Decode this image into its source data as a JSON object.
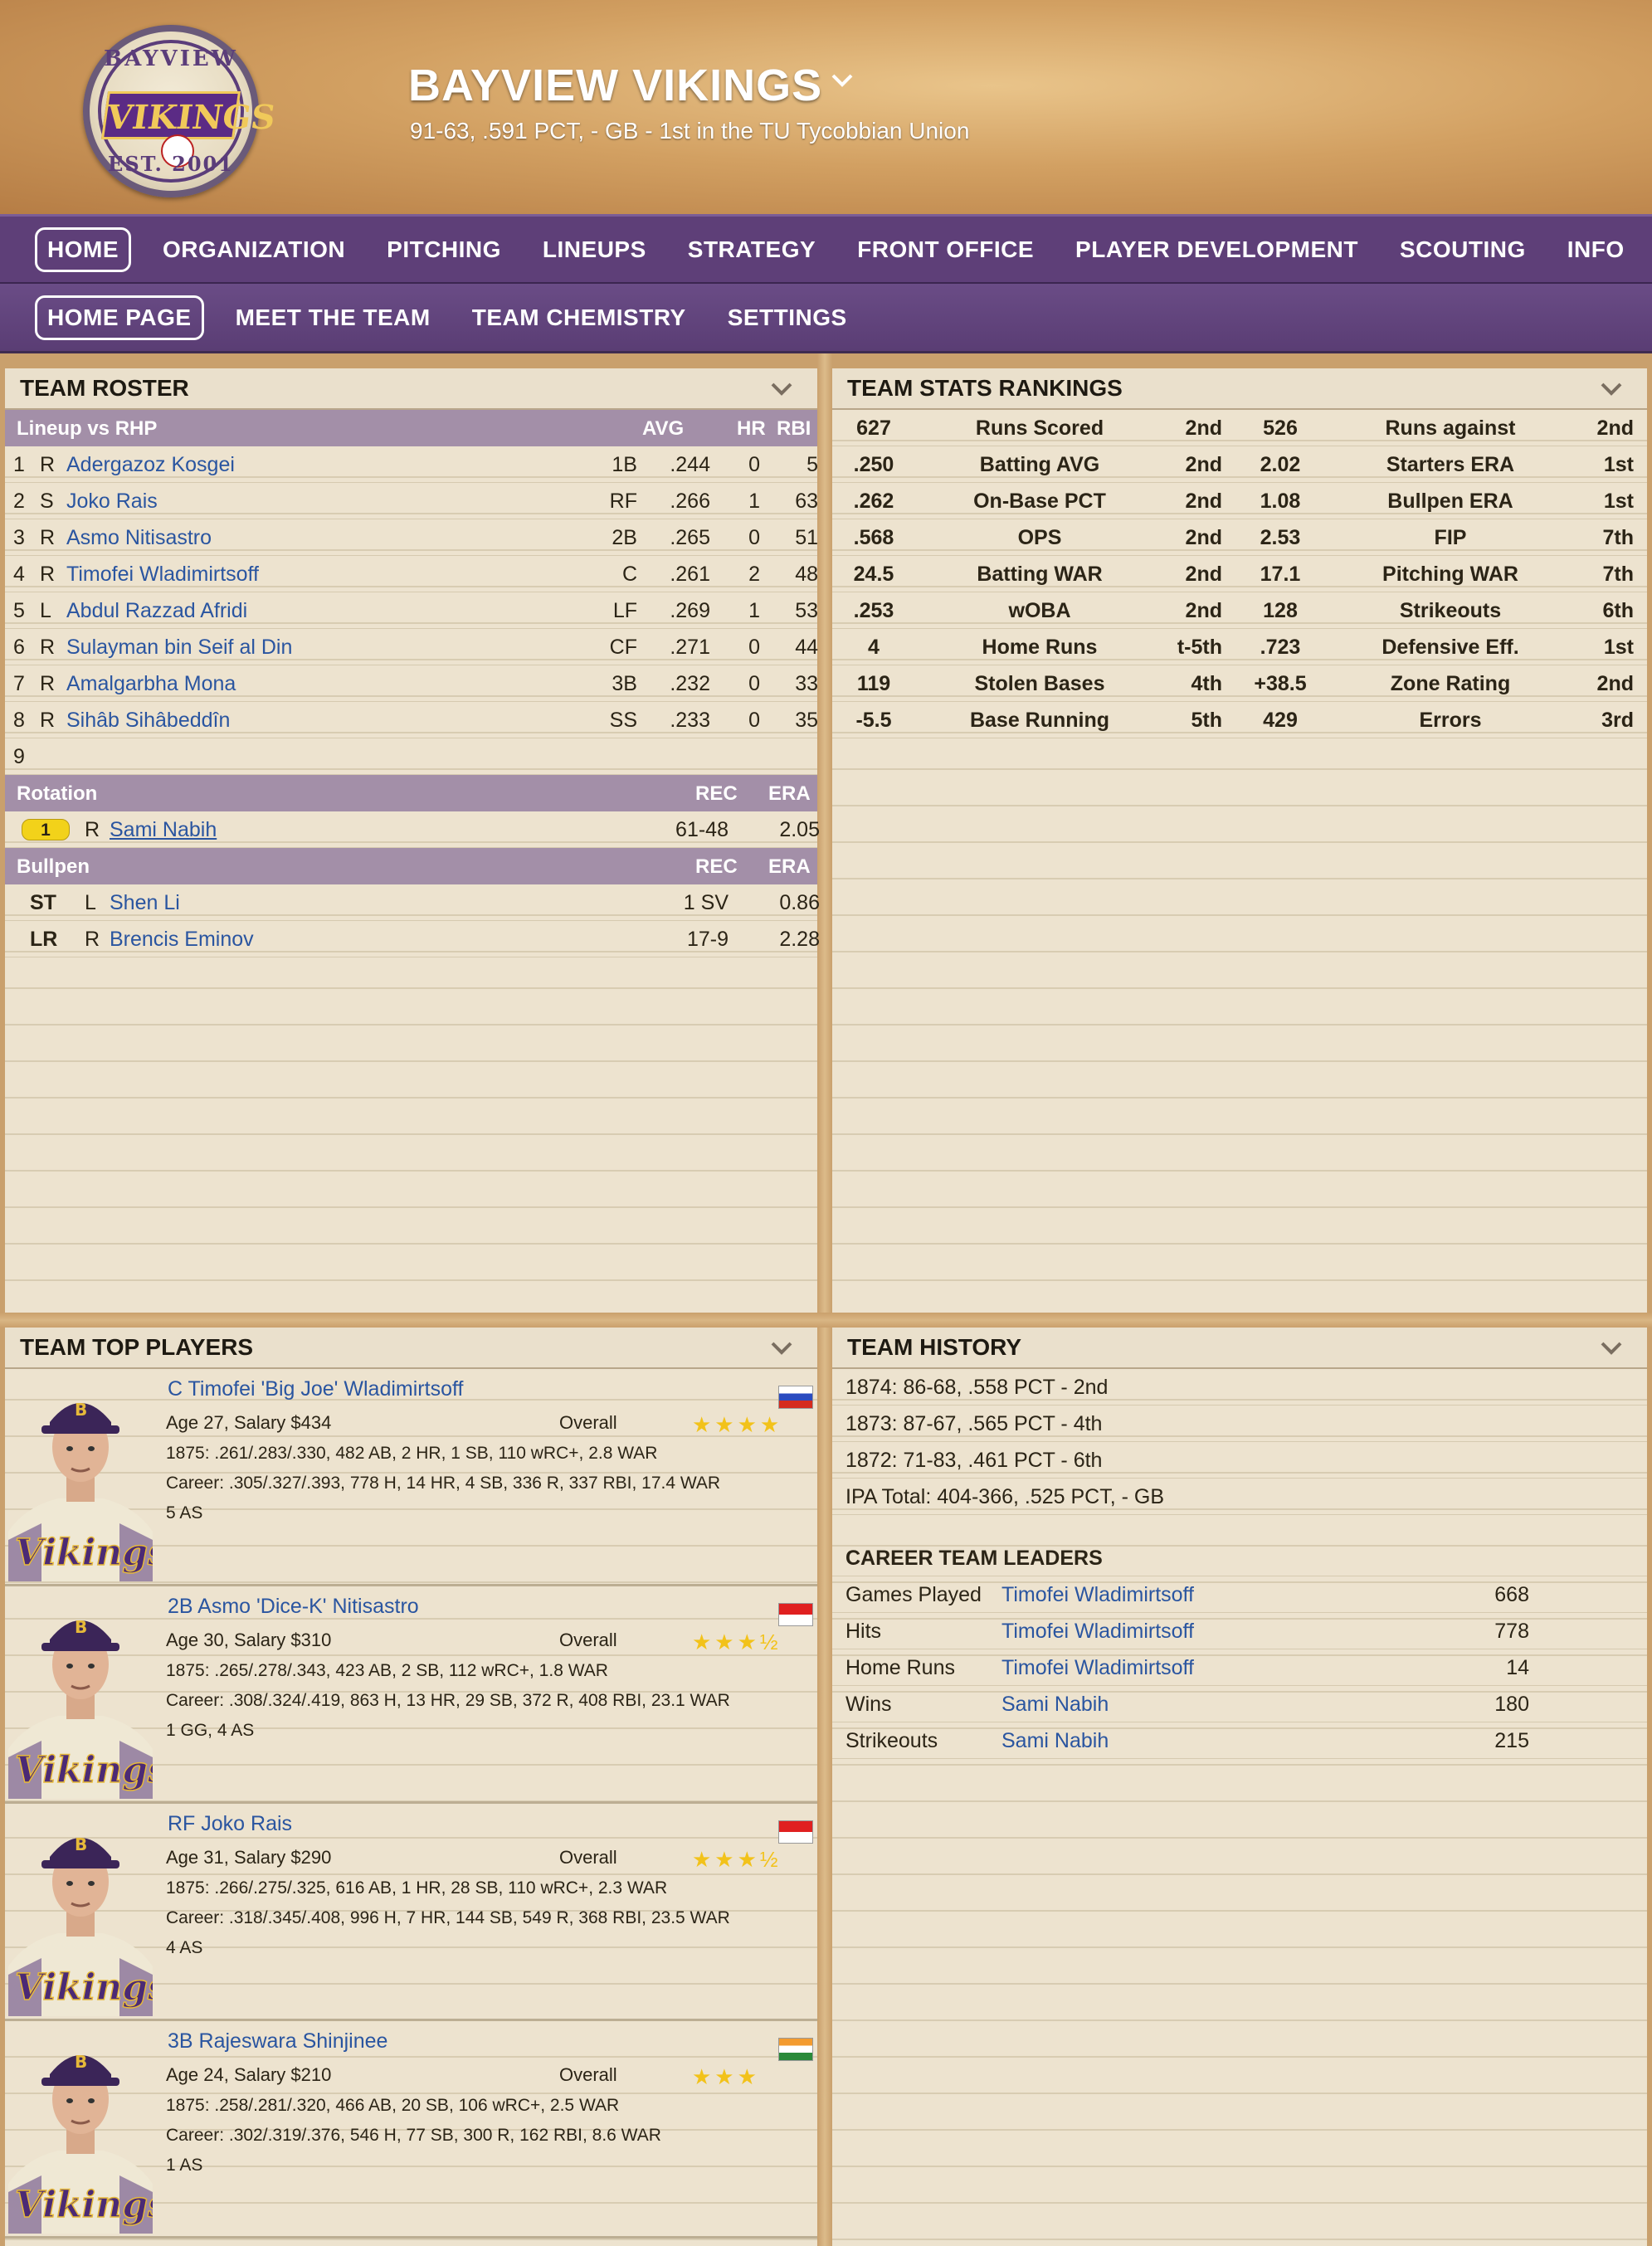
{
  "header": {
    "team_name": "BAYVIEW VIKINGS",
    "subtitle": "91-63, .591 PCT, - GB - 1st in the TU Tycobbian Union",
    "logo": {
      "top": "BAYVIEW",
      "word": "VIKINGS",
      "bottom": "EST. 2001"
    }
  },
  "nav": {
    "primary": [
      "HOME",
      "ORGANIZATION",
      "PITCHING",
      "LINEUPS",
      "STRATEGY",
      "FRONT OFFICE",
      "PLAYER DEVELOPMENT",
      "SCOUTING",
      "INFO"
    ],
    "secondary": [
      "HOME PAGE",
      "MEET THE TEAM",
      "TEAM CHEMISTRY",
      "SETTINGS"
    ]
  },
  "roster": {
    "title": "TEAM ROSTER",
    "lineup_header": {
      "label": "Lineup vs RHP",
      "avg": "AVG",
      "hr": "HR",
      "rbi": "RBI"
    },
    "lineup": [
      {
        "n": "1",
        "h": "R",
        "name": "Adergazoz Kosgei",
        "pos": "1B",
        "avg": ".244",
        "hr": "0",
        "rbi": "5"
      },
      {
        "n": "2",
        "h": "S",
        "name": "Joko Rais",
        "pos": "RF",
        "avg": ".266",
        "hr": "1",
        "rbi": "63"
      },
      {
        "n": "3",
        "h": "R",
        "name": "Asmo Nitisastro",
        "pos": "2B",
        "avg": ".265",
        "hr": "0",
        "rbi": "51"
      },
      {
        "n": "4",
        "h": "R",
        "name": "Timofei Wladimirtsoff",
        "pos": "C",
        "avg": ".261",
        "hr": "2",
        "rbi": "48"
      },
      {
        "n": "5",
        "h": "L",
        "name": "Abdul Razzad Afridi",
        "pos": "LF",
        "avg": ".269",
        "hr": "1",
        "rbi": "53"
      },
      {
        "n": "6",
        "h": "R",
        "name": "Sulayman bin Seif al Din",
        "pos": "CF",
        "avg": ".271",
        "hr": "0",
        "rbi": "44"
      },
      {
        "n": "7",
        "h": "R",
        "name": "Amalgarbha Mona",
        "pos": "3B",
        "avg": ".232",
        "hr": "0",
        "rbi": "33"
      },
      {
        "n": "8",
        "h": "R",
        "name": "Sihâb Sihâbeddîn",
        "pos": "SS",
        "avg": ".233",
        "hr": "0",
        "rbi": "35"
      },
      {
        "n": "9",
        "h": "",
        "name": "",
        "pos": "",
        "avg": "",
        "hr": "",
        "rbi": ""
      }
    ],
    "rotation_header": {
      "label": "Rotation",
      "rec": "REC",
      "era": "ERA"
    },
    "rotation": [
      {
        "slot": "1",
        "h": "R",
        "name": "Sami Nabih",
        "rec": "61-48",
        "era": "2.05"
      }
    ],
    "bullpen_header": {
      "label": "Bullpen",
      "rec": "REC",
      "era": "ERA"
    },
    "bullpen": [
      {
        "role": "ST",
        "h": "L",
        "name": "Shen Li",
        "rec": "1 SV",
        "era": "0.86"
      },
      {
        "role": "LR",
        "h": "R",
        "name": "Brencis Eminov",
        "rec": "17-9",
        "era": "2.28"
      }
    ]
  },
  "rankings": {
    "title": "TEAM STATS RANKINGS",
    "rows": [
      {
        "v1": "627",
        "s1": "Runs Scored",
        "r1": "2nd",
        "v2": "526",
        "s2": "Runs against",
        "r2": "2nd"
      },
      {
        "v1": ".250",
        "s1": "Batting AVG",
        "r1": "2nd",
        "v2": "2.02",
        "s2": "Starters ERA",
        "r2": "1st"
      },
      {
        "v1": ".262",
        "s1": "On-Base PCT",
        "r1": "2nd",
        "v2": "1.08",
        "s2": "Bullpen ERA",
        "r2": "1st"
      },
      {
        "v1": ".568",
        "s1": "OPS",
        "r1": "2nd",
        "v2": "2.53",
        "s2": "FIP",
        "r2": "7th"
      },
      {
        "v1": "24.5",
        "s1": "Batting WAR",
        "r1": "2nd",
        "v2": "17.1",
        "s2": "Pitching WAR",
        "r2": "7th"
      },
      {
        "v1": ".253",
        "s1": "wOBA",
        "r1": "2nd",
        "v2": "128",
        "s2": "Strikeouts",
        "r2": "6th"
      },
      {
        "v1": "4",
        "s1": "Home Runs",
        "r1": "t-5th",
        "v2": ".723",
        "s2": "Defensive Eff.",
        "r2": "1st"
      },
      {
        "v1": "119",
        "s1": "Stolen Bases",
        "r1": "4th",
        "v2": "+38.5",
        "s2": "Zone Rating",
        "r2": "2nd"
      },
      {
        "v1": "-5.5",
        "s1": "Base Running",
        "r1": "5th",
        "v2": "429",
        "s2": "Errors",
        "r2": "3rd"
      }
    ]
  },
  "top_players": {
    "title": "TEAM TOP PLAYERS",
    "overall_label": "Overall",
    "players": [
      {
        "name": "C Timofei 'Big Joe' Wladimirtsoff",
        "age_salary": "Age 27, Salary $434",
        "stars": "★★★★",
        "line": "1875: .261/.283/.330, 482 AB, 2 HR, 1 SB, 110 wRC+, 2.8 WAR",
        "career": "Career: .305/.327/.393, 778 H, 14 HR, 4 SB, 336 R, 337 RBI, 17.4 WAR",
        "awards": "5 AS",
        "flag": "russia"
      },
      {
        "name": "2B Asmo 'Dice-K' Nitisastro",
        "age_salary": "Age 30, Salary $310",
        "stars": "★★★½",
        "line": "1875: .265/.278/.343, 423 AB, 2 SB, 112 wRC+, 1.8 WAR",
        "career": "Career: .308/.324/.419, 863 H, 13 HR, 29 SB, 372 R, 408 RBI, 23.1 WAR",
        "awards": "1 GG, 4 AS",
        "flag": "indonesia"
      },
      {
        "name": "RF Joko Rais",
        "age_salary": "Age 31, Salary $290",
        "stars": "★★★½",
        "line": "1875: .266/.275/.325, 616 AB, 1 HR, 28 SB, 110 wRC+, 2.3 WAR",
        "career": "Career: .318/.345/.408, 996 H, 7 HR, 144 SB, 549 R, 368 RBI, 23.5 WAR",
        "awards": "4 AS",
        "flag": "indonesia"
      },
      {
        "name": "3B Rajeswara Shinjinee",
        "age_salary": "Age 24, Salary $210",
        "stars": "★★★",
        "line": "1875: .258/.281/.320, 466 AB, 20 SB, 106 wRC+, 2.5 WAR",
        "career": "Career: .302/.319/.376, 546 H, 77 SB, 300 R, 162 RBI, 8.6 WAR",
        "awards": "1 AS",
        "flag": "india"
      }
    ]
  },
  "history": {
    "title": "TEAM HISTORY",
    "seasons": [
      "1874: 86-68, .558 PCT - 2nd",
      "1873: 87-67, .565 PCT - 4th",
      "1872: 71-83, .461 PCT - 6th",
      "IPA Total: 404-366, .525 PCT, - GB"
    ],
    "leaders_title": "CAREER TEAM LEADERS",
    "leaders": [
      {
        "cat": "Games Played",
        "name": "Timofei Wladimirtsoff",
        "val": "668"
      },
      {
        "cat": "Hits",
        "name": "Timofei Wladimirtsoff",
        "val": "778"
      },
      {
        "cat": "Home Runs",
        "name": "Timofei Wladimirtsoff",
        "val": "14"
      },
      {
        "cat": "Wins",
        "name": "Sami Nabih",
        "val": "180"
      },
      {
        "cat": "Strikeouts",
        "name": "Sami Nabih",
        "val": "215"
      }
    ]
  },
  "colors": {
    "nav": "#5e3f78",
    "group_header": "#a38fa8",
    "link": "#2a55a0",
    "star": "#f2c21a"
  }
}
